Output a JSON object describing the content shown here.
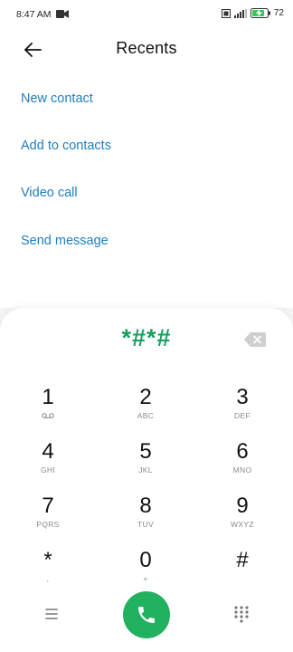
{
  "status_bar": {
    "time": "8:47 AM",
    "battery_percent": "72"
  },
  "header": {
    "title": "Recents",
    "back_icon": "arrow-left-icon"
  },
  "actions": [
    {
      "label": "New contact"
    },
    {
      "label": "Add to contacts"
    },
    {
      "label": "Video call"
    },
    {
      "label": "Send message"
    }
  ],
  "dialer": {
    "number": "*#*#",
    "keys": [
      {
        "digit": "1",
        "sub": ""
      },
      {
        "digit": "2",
        "sub": "ABC"
      },
      {
        "digit": "3",
        "sub": "DEF"
      },
      {
        "digit": "4",
        "sub": "GHI"
      },
      {
        "digit": "5",
        "sub": "JKL"
      },
      {
        "digit": "6",
        "sub": "MNO"
      },
      {
        "digit": "7",
        "sub": "PQRS"
      },
      {
        "digit": "8",
        "sub": "TUV"
      },
      {
        "digit": "9",
        "sub": "WXYZ"
      },
      {
        "digit": "*",
        "sub": ","
      },
      {
        "digit": "0",
        "sub": "+"
      },
      {
        "digit": "#",
        "sub": ""
      }
    ]
  },
  "colors": {
    "accent_link": "#1f7fc0",
    "dial_green": "#16a05f",
    "call_button": "#22b15e"
  }
}
